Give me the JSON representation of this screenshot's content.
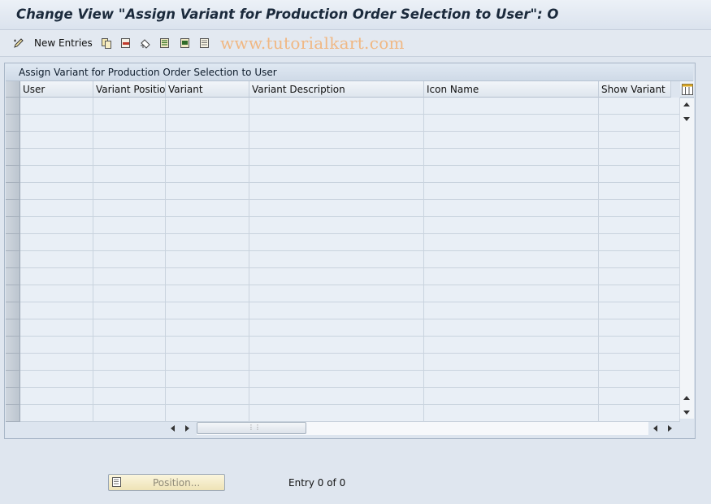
{
  "window": {
    "title": "Change View \"Assign Variant for Production Order Selection to User\": O"
  },
  "toolbar": {
    "new_entries_label": "New Entries",
    "icons": [
      "edit-pencil-icon",
      "copy-icon",
      "delete-icon",
      "undo-icon",
      "select-all-icon",
      "select-block-icon",
      "deselect-all-icon"
    ]
  },
  "watermark": "www.tutorialkart.com",
  "table": {
    "title": "Assign Variant for Production Order Selection to User",
    "columns": [
      "User",
      "Variant Position",
      "Variant",
      "Variant Description",
      "Icon Name",
      "Show Variant"
    ],
    "row_count": 19
  },
  "footer": {
    "position_label": "Position...",
    "entry_text": "Entry 0 of 0"
  }
}
